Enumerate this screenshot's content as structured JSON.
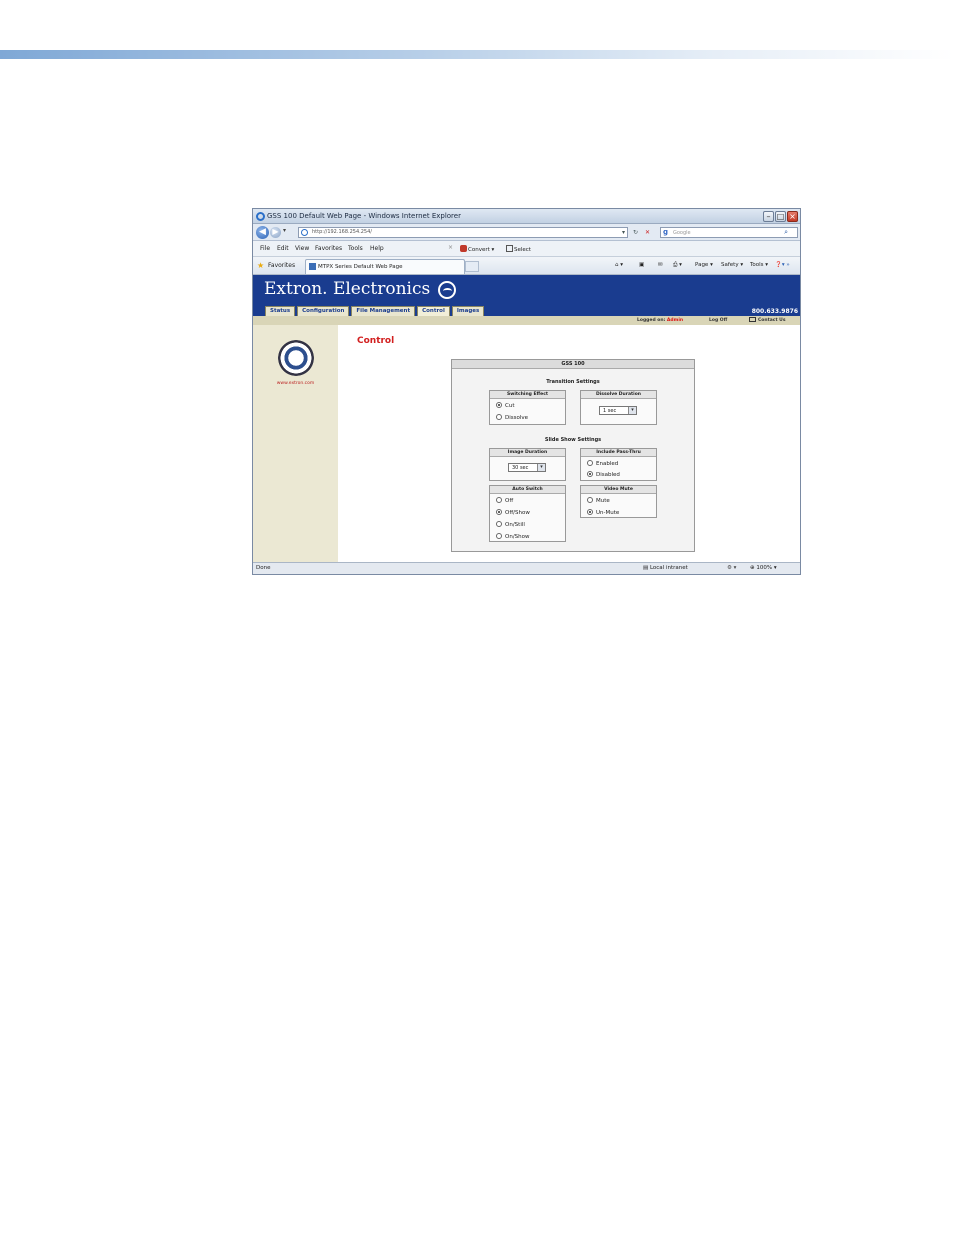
{
  "browser": {
    "title": "GSS 100 Default Web Page - Windows Internet Explorer",
    "url": "http://192.168.254.254/",
    "search_placeholder": "Google",
    "menu": [
      "File",
      "Edit",
      "View",
      "Favorites",
      "Tools",
      "Help"
    ],
    "toolbar": {
      "convert": "Convert",
      "select": "Select"
    },
    "favorites_label": "Favorites",
    "tab_title": "MTPX Series Default Web Page",
    "commands": {
      "page": "Page",
      "safety": "Safety",
      "tools": "Tools"
    },
    "status": {
      "left": "Done",
      "zone": "Local intranet",
      "zoom": "100%"
    }
  },
  "site": {
    "brand": "Extron. Electronics",
    "phone": "800.633.9876",
    "tabs": [
      "Status",
      "Configuration",
      "File Management",
      "Control",
      "Images"
    ],
    "active_tab": "Control",
    "logged_on_label": "Logged on:",
    "logged_on_user": "Admin",
    "log_off": "Log Off",
    "contact": "Contact Us",
    "side_url": "www.extron.com",
    "page_title": "Control"
  },
  "panel": {
    "title": "GSS 100",
    "transition_settings": "Transition Settings",
    "slide_show_settings": "Slide Show Settings",
    "switching_effect": {
      "label": "Switching Effect",
      "options": [
        "Cut",
        "Dissolve"
      ],
      "selected": "Cut"
    },
    "dissolve_duration": {
      "label": "Dissolve Duration",
      "value": "1 sec"
    },
    "image_duration": {
      "label": "Image Duration",
      "value": "30 sec"
    },
    "include_pass_thru": {
      "label": "Include Pass-Thru",
      "options": [
        "Enabled",
        "Disabled"
      ],
      "selected": "Disabled"
    },
    "auto_switch": {
      "label": "Auto Switch",
      "options": [
        "Off",
        "Off/Show",
        "On/Still",
        "On/Show"
      ],
      "selected": "Off/Show"
    },
    "video_mute": {
      "label": "Video Mute",
      "options": [
        "Mute",
        "Un-Mute"
      ],
      "selected": "Un-Mute"
    }
  },
  "colors": {
    "header_blue": "#1a3c8f",
    "title_red": "#d22020",
    "side_bg": "#ebe8d3"
  }
}
